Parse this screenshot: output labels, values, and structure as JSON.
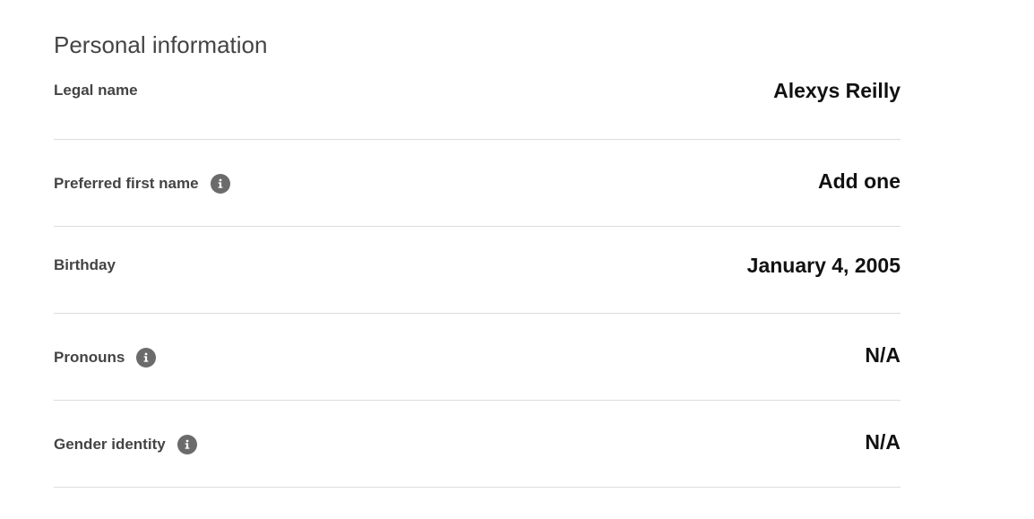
{
  "section": {
    "title": "Personal information"
  },
  "rows": [
    {
      "label": "Legal name",
      "value": "Alexys Reilly",
      "has_info": false
    },
    {
      "label": "Preferred first name",
      "value": "Add one",
      "has_info": true,
      "info_icon": "info-icon"
    },
    {
      "label": "Birthday",
      "value": "January 4, 2005",
      "has_info": false
    },
    {
      "label": "Pronouns",
      "value": "N/A",
      "has_info": true,
      "info_icon": "info-icon"
    },
    {
      "label": "Gender identity",
      "value": "N/A",
      "has_info": true,
      "info_icon": "info-icon"
    }
  ],
  "colors": {
    "divider": "#dddddd",
    "label_text": "#444444",
    "value_text": "#111111",
    "info_icon_bg": "#6b6b6b"
  }
}
